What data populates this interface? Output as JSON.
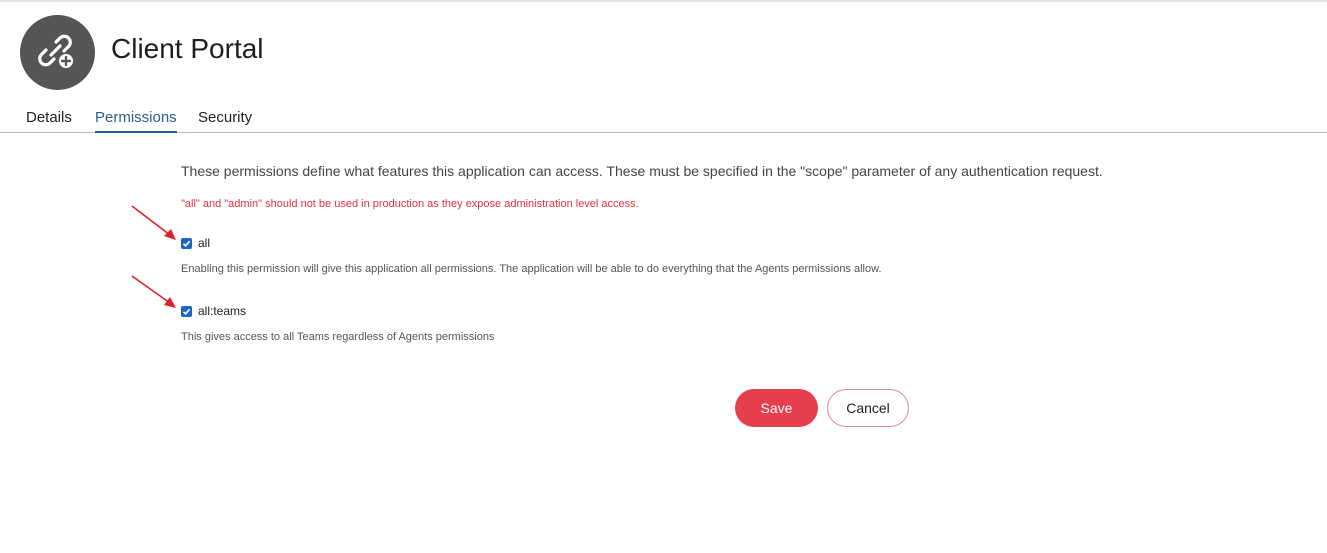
{
  "app": {
    "title": "Client Portal",
    "icon": "link-add-icon"
  },
  "tabs": [
    {
      "label": "Details",
      "active": false
    },
    {
      "label": "Permissions",
      "active": true
    },
    {
      "label": "Security",
      "active": false
    }
  ],
  "permissions": {
    "intro": "These permissions define what features this application can access. These must be specified in the \"scope\" parameter of any authentication request.",
    "warning": "\"all\" and \"admin\" should not be used in production as they expose administration level access.",
    "items": [
      {
        "label": "all",
        "checked": true,
        "description": "Enabling this permission will give this application all permissions. The application will be able to do everything that the Agents permissions allow."
      },
      {
        "label": "all:teams",
        "checked": true,
        "description": "This gives access to all Teams regardless of Agents permissions"
      }
    ]
  },
  "actions": {
    "save_label": "Save",
    "cancel_label": "Cancel"
  },
  "colors": {
    "accent": "#2a5d8f",
    "primary_button": "#e53e4d",
    "warning_text": "#e0323e",
    "checkbox": "#1a66c7",
    "annotation_arrow": "#e0202a"
  }
}
